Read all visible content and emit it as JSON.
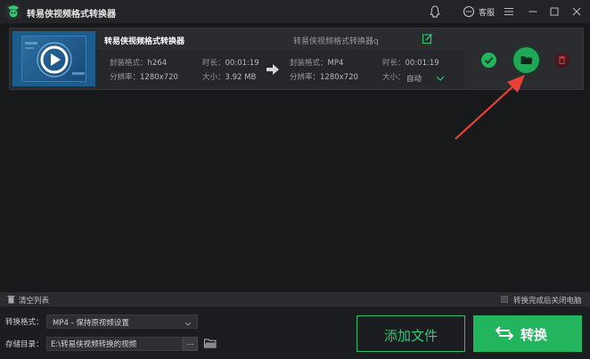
{
  "app": {
    "title": "转易侠视频格式转换器"
  },
  "titlebar": {
    "customer_service_label": "客服"
  },
  "task": {
    "source_name": "转易侠视频格式转换器",
    "output_name": "转易侠视频格式转换器q",
    "source": {
      "format_label": "封装格式：",
      "format_value": "h264",
      "resolution_label": "分辨率",
      "resolution_value": "：1280x720",
      "duration_label": "时长：",
      "duration_value": "00:01:19",
      "size_label": "大小：",
      "size_value": "3.92 MB"
    },
    "output": {
      "format_label": "封装格式：",
      "format_value": "MP4",
      "resolution_label": "分辨率",
      "resolution_value": "：1280x720",
      "duration_label": "时长：",
      "duration_value": "00:01:19",
      "size_label": "大小：",
      "size_value": "自动"
    }
  },
  "bottom_bar": {
    "clear_list_label": "清空列表",
    "shutdown_label": "转换完成后关闭电脑"
  },
  "footer": {
    "format_label": "转换格式：",
    "format_value": "MP4 - 保持原视频设置",
    "dir_label": "存储目录：",
    "dir_value": "E:\\转易侠视频转换的视频",
    "browse_label": "...",
    "add_file_label": "添加文件",
    "convert_label": "转换"
  },
  "colors": {
    "accent": "#23b45e",
    "background": "#18191b",
    "annotation_arrow": "#e8413a"
  }
}
